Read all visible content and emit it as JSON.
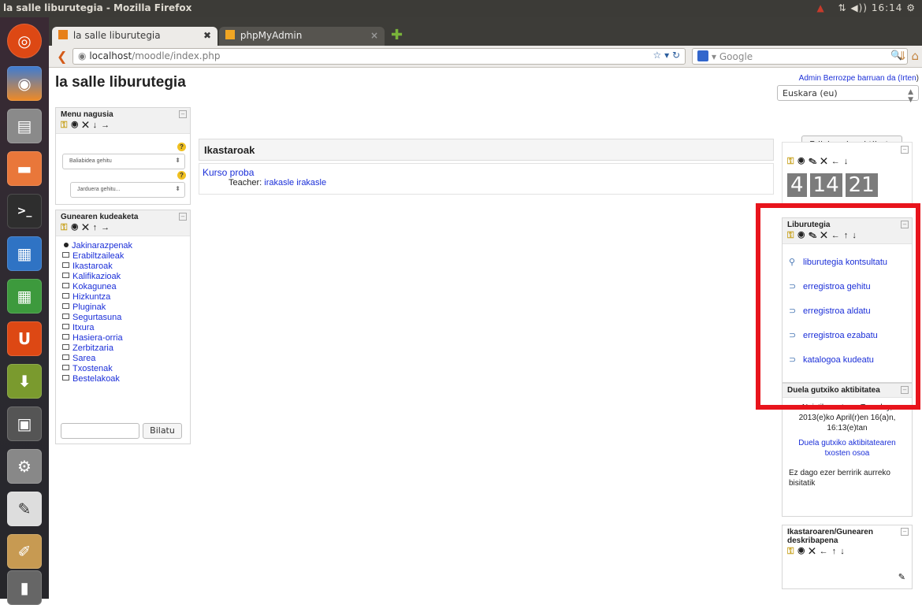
{
  "window_title": "la salle liburutegia - Mozilla Firefox",
  "tray": {
    "time": "16:14"
  },
  "tabs": [
    {
      "label": "la salle liburutegia",
      "close": "✖"
    },
    {
      "label": "phpMyAdmin",
      "close": "×"
    }
  ],
  "urlbar": {
    "host": "localhost",
    "path": "/moodle/index.php"
  },
  "search": {
    "placeholder": "Google"
  },
  "site": {
    "name": "la salle liburutegia"
  },
  "login_info": {
    "prefix": "Admin Berrozpe barruan da (",
    "logout": "Irten",
    "suffix": ")"
  },
  "language": {
    "selected": "Euskara (eu)"
  },
  "main_menu": {
    "title": "Menu nagusia",
    "add_resource": "Baliabidea gehitu",
    "add_activity": "Jarduera gehitu..."
  },
  "admin_block": {
    "title": "Gunearen kudeaketa",
    "items": [
      "Jakinarazpenak",
      "Erabiltzaileak",
      "Ikastaroak",
      "Kalifikazioak",
      "Kokagunea",
      "Hizkuntza",
      "Pluginak",
      "Segurtasuna",
      "Itxura",
      "Hasiera-orria",
      "Zerbitzaria",
      "Sarea",
      "Txostenak",
      "Bestelakoak"
    ],
    "search_button": "Bilatu"
  },
  "courses": {
    "heading": "Ikastaroak",
    "course_name": "Kurso proba",
    "teacher_label": "Teacher: ",
    "teacher_name": "irakasle irakasle"
  },
  "edit_button": "Edizioa desaktibatu",
  "clock": {
    "d1": "4",
    "d2": "14",
    "d3": "21"
  },
  "library_block": {
    "title": "Liburutegia",
    "links": [
      "liburutegia kontsultatu",
      "erregistroa gehitu",
      "erregistroa aldatu",
      "erregistroa ezabatu",
      "katalogoa kudeatu"
    ]
  },
  "recent_block": {
    "title": "Duela gutxiko aktibitatea",
    "since": "Noiztik martxan: Tuesday, 2013(e)ko April(r)en 16(a)n, 16:13(e)tan",
    "full_report": "Duela gutxiko aktibitatearen txosten osoa",
    "nothing_new": "Ez dago ezer berririk aurreko bisitatik"
  },
  "desc_block": {
    "title": "Ikastaroaren/Gunearen deskribapena"
  },
  "colors": {
    "highlight": "#e8141c",
    "link": "#1b2fd8",
    "topbar": "#3c3b37"
  }
}
